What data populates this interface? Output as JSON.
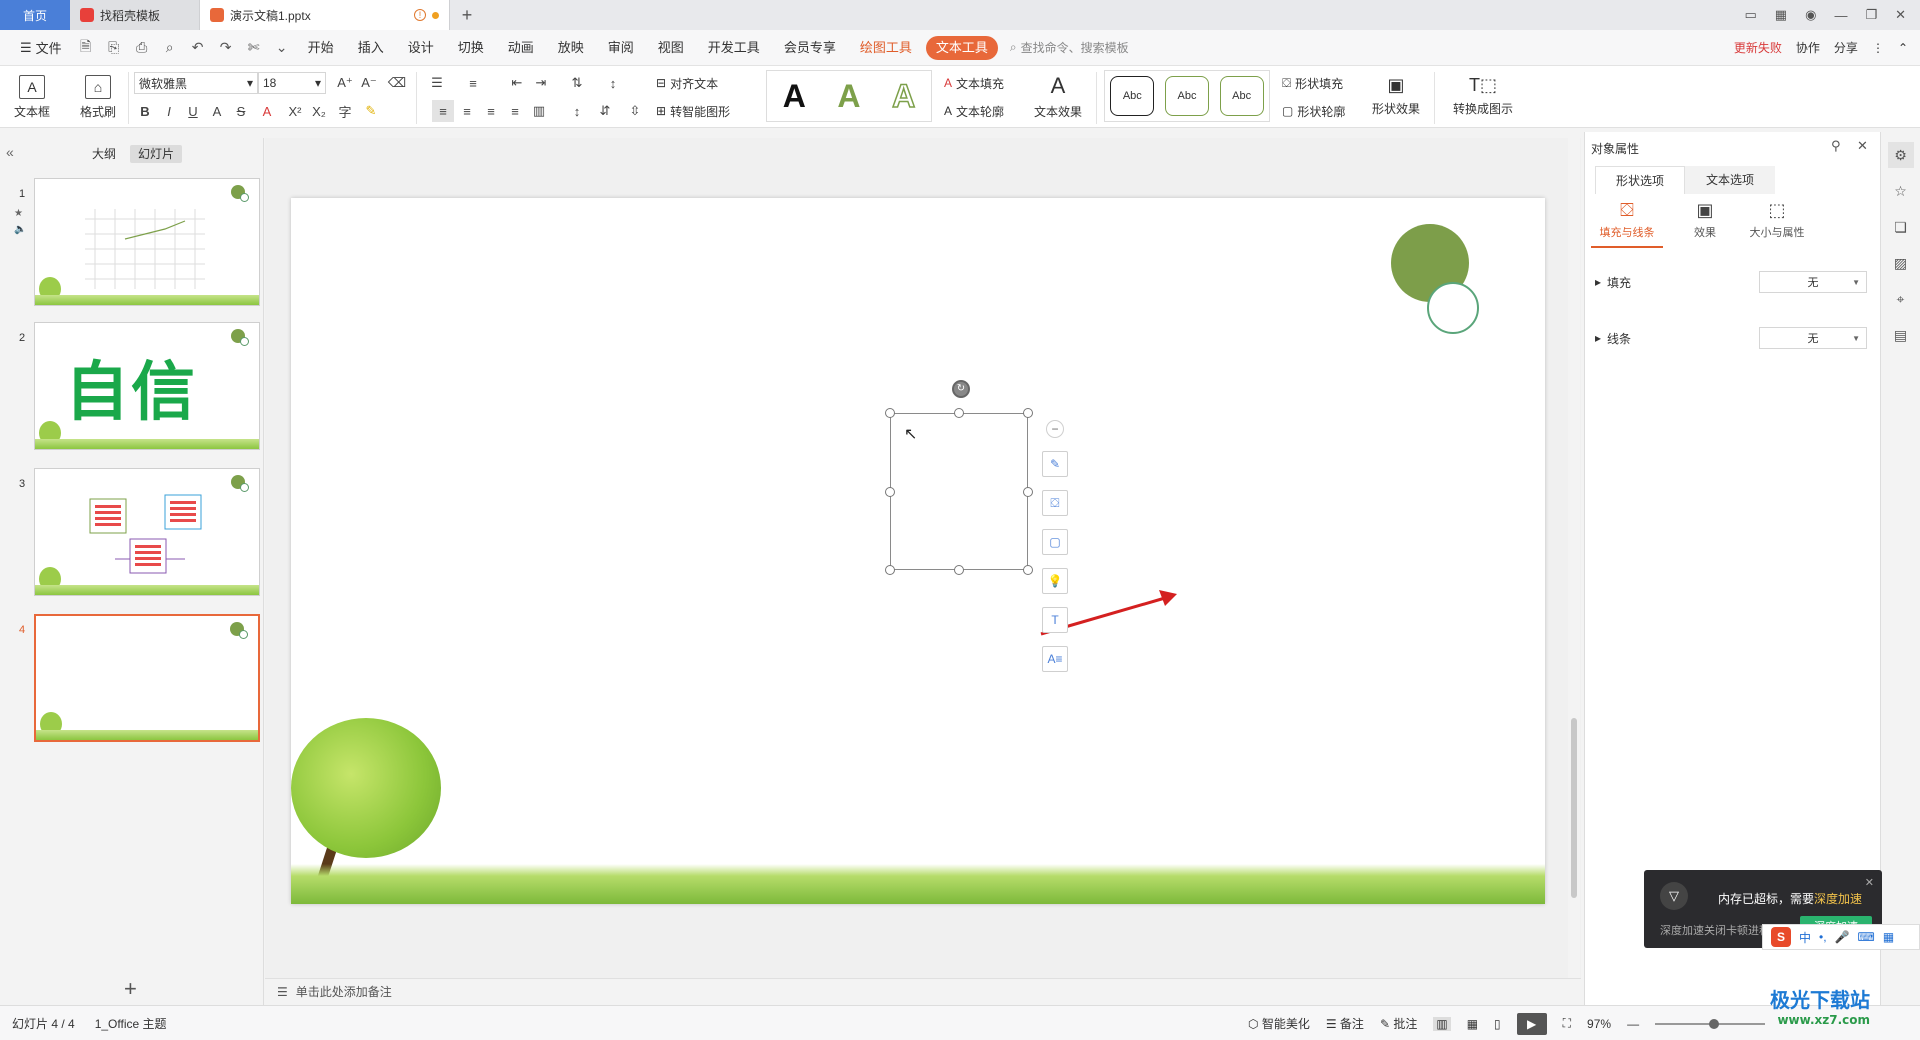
{
  "titlebar": {
    "home_tab": "首页",
    "tab1": "找稻壳模板",
    "tab2": "演示文稿1.pptx",
    "plus": "+"
  },
  "menubar": {
    "file": "文件",
    "items": [
      "开始",
      "插入",
      "设计",
      "切换",
      "动画",
      "放映",
      "审阅",
      "视图",
      "开发工具",
      "会员专享"
    ],
    "draw_tools": "绘图工具",
    "text_tools": "文本工具",
    "search": "查找命令、搜索模板",
    "right": [
      "更新失败",
      "协作",
      "分享"
    ]
  },
  "ribbon": {
    "textbox": "文本框",
    "format_painter": "格式刷",
    "font": "微软雅黑",
    "size": "18",
    "align_text": "对齐文本",
    "smart_shape": "转智能图形",
    "wordart": [
      "A",
      "A",
      "A"
    ],
    "text_fill": "文本填充",
    "text_outline": "文本轮廓",
    "text_effect": "文本效果",
    "styles": [
      "Abc",
      "Abc",
      "Abc"
    ],
    "shape_fill": "形状填充",
    "shape_outline": "形状轮廓",
    "shape_effect": "形状效果",
    "convert": "转换成图示"
  },
  "leftpanel": {
    "tabs": [
      "大纲",
      "幻灯片"
    ],
    "slides": [
      {
        "num": "1"
      },
      {
        "num": "2",
        "text": "自信"
      },
      {
        "num": "3"
      },
      {
        "num": "4"
      }
    ],
    "add": "+"
  },
  "notes": "单击此处添加备注",
  "props": {
    "header": "对象属性",
    "tabs": [
      "形状选项",
      "文本选项"
    ],
    "sub": [
      "填充与线条",
      "效果",
      "大小与属性"
    ],
    "rows": [
      {
        "label": "填充",
        "value": "无"
      },
      {
        "label": "线条",
        "value": "无"
      }
    ]
  },
  "toast": {
    "title_pre": "内存已超标，需要",
    "title_hl": "深度加速",
    "desc": "深度加速关闭卡顿进程",
    "button": "深度加速"
  },
  "ime": {
    "lang": "中"
  },
  "status": {
    "slide": "幻灯片 4 / 4",
    "theme": "1_Office 主题",
    "beautify": "智能美化",
    "notes": "备注",
    "comment": "批注",
    "zoom": "97%"
  },
  "watermark": {
    "name": "极光下载站",
    "url": "www.xz7.com"
  },
  "colors": {
    "accent": "#e8683a",
    "home_tab": "#4a7fd8",
    "slide_dot": "#7d9e4a",
    "arrow": "#d42020"
  }
}
